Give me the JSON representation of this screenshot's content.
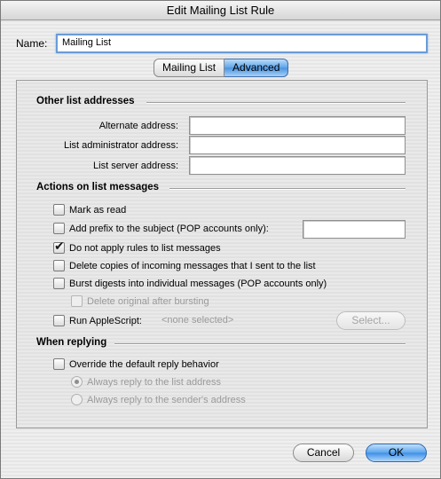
{
  "window": {
    "title": "Edit Mailing List Rule"
  },
  "name": {
    "label": "Name:",
    "value": "Mailing List"
  },
  "tabs": [
    {
      "label": "Mailing List",
      "active": false
    },
    {
      "label": "Advanced",
      "active": true
    }
  ],
  "other_addresses": {
    "title": "Other list addresses",
    "alternate_label": "Alternate address:",
    "alternate_value": "",
    "admin_label": "List administrator address:",
    "admin_value": "",
    "server_label": "List server address:",
    "server_value": ""
  },
  "actions": {
    "title": "Actions on list messages",
    "mark_read": {
      "label": "Mark as read",
      "checked": false
    },
    "add_prefix": {
      "label": "Add prefix to the subject (POP accounts only):",
      "checked": false,
      "value": ""
    },
    "no_rules": {
      "label": "Do not apply rules to list messages",
      "checked": true
    },
    "delete_copies": {
      "label": "Delete copies of incoming messages that I sent to the list",
      "checked": false
    },
    "burst": {
      "label": "Burst digests into individual messages (POP accounts only)",
      "checked": false
    },
    "delete_original": {
      "label": "Delete original after bursting",
      "checked": false,
      "enabled": false
    },
    "applescript": {
      "label": "Run AppleScript:",
      "checked": false,
      "status": "<none selected>",
      "select_label": "Select..."
    }
  },
  "replying": {
    "title": "When replying",
    "override": {
      "label": "Override the default reply behavior",
      "checked": false
    },
    "reply_list": {
      "label": "Always reply to the list address",
      "selected": true
    },
    "reply_sender": {
      "label": "Always reply to the sender's address",
      "selected": false
    }
  },
  "buttons": {
    "cancel": "Cancel",
    "ok": "OK"
  }
}
